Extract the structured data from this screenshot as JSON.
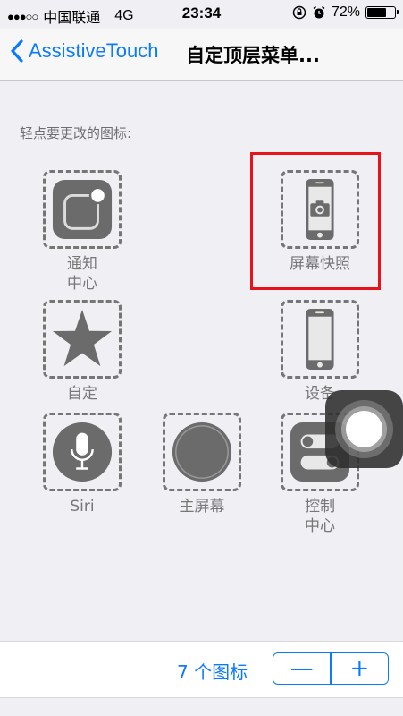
{
  "status_bar": {
    "signal_dots": "●●●○○",
    "carrier": "中国联通",
    "network": "4G",
    "time": "23:34",
    "battery_percent": "72%",
    "battery_level": 0.72
  },
  "nav": {
    "back_label": "AssistiveTouch",
    "title": "自定顶层菜单..."
  },
  "section_header": "轻点要更改的图标:",
  "icons": [
    {
      "label": "通知\n中心",
      "icon": "notification-center-icon"
    },
    {
      "label": "屏幕快照",
      "icon": "screenshot-icon"
    },
    {
      "label": "自定",
      "icon": "custom-star-icon"
    },
    {
      "label": "设备",
      "icon": "device-icon"
    },
    {
      "label": "Siri",
      "icon": "siri-microphone-icon"
    },
    {
      "label": "主屏幕",
      "icon": "home-button-icon"
    },
    {
      "label": "控制\n中心",
      "icon": "control-center-icon"
    }
  ],
  "bottom": {
    "count_label": "7 个图标",
    "minus": "—",
    "plus": "+"
  },
  "colors": {
    "accent": "#0a7aff",
    "highlight": "#e8131a",
    "icon_gray": "#6b6b6b"
  }
}
